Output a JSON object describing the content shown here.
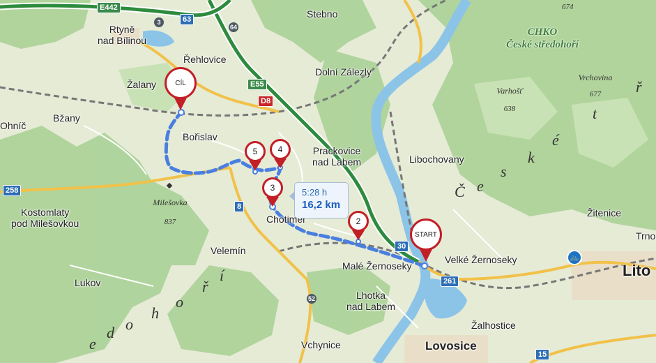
{
  "map": {
    "places": {
      "rtyne": "Rtyně\nnad Bílinou",
      "stebno": "Stebno",
      "rehlovice": "Řehlovice",
      "dolni_zalezly": "Dolní Zálezly",
      "zalany": "Žalany",
      "bzany": "Bžany",
      "ohnic": "Ohníč",
      "borislav": "Bořislav",
      "prackovice": "Prackovice\nnad Labem",
      "libochovany": "Libochovany",
      "kostomlaty": "Kostomlaty\npod Milešovkou",
      "chotimer": "Chotiměř",
      "velemin": "Velemín",
      "male_zernoseky": "Malé Žernoseky",
      "velke_zernoseky": "Velké Žernoseky",
      "lukov": "Lukov",
      "lhotka": "Lhotka\nnad Labem",
      "zalhostice": "Žalhostice",
      "vchynice": "Vchynice",
      "lovosice": "Lovosice",
      "litomerice": "Lito",
      "zitenice": "Žitenice",
      "trnovany": "Trno"
    },
    "peaks": {
      "milesovka_name": "Milešovka",
      "milesovka_alt": "837",
      "varhost_name": "Varhošť",
      "varhost_alt": "638",
      "vrchovina_name": "Vrchovina",
      "vrchovina_alt": "677",
      "alt_674": "674"
    },
    "protected_area": {
      "line1": "CHKO",
      "line2": "České středohoří"
    },
    "range_letters": [
      "Č",
      "e",
      "s",
      "k",
      "é",
      "s",
      "t",
      "ř",
      "e",
      "d",
      "o",
      "h",
      "o",
      "ř",
      "í"
    ],
    "road_shields": {
      "e442": "E442",
      "r63": "63",
      "r64": "64",
      "e55": "E55",
      "d8": "D8",
      "r8": "8",
      "r258": "258",
      "r30": "30",
      "r261": "261",
      "r15": "15",
      "r3": "3",
      "r52": "52"
    },
    "markers": {
      "start": "START",
      "finish": "CÍL",
      "wp2": "2",
      "wp3": "3",
      "wp4": "4",
      "wp5": "5"
    },
    "route_info": {
      "time": "5:28 h",
      "distance": "16,2 km"
    },
    "colors": {
      "route": "#4a7fe0",
      "marker": "#c21f27",
      "forest": "#a9cf94",
      "river": "#8cc4e8",
      "highway": "#2e8b3e",
      "road": "#f1c14a"
    }
  }
}
